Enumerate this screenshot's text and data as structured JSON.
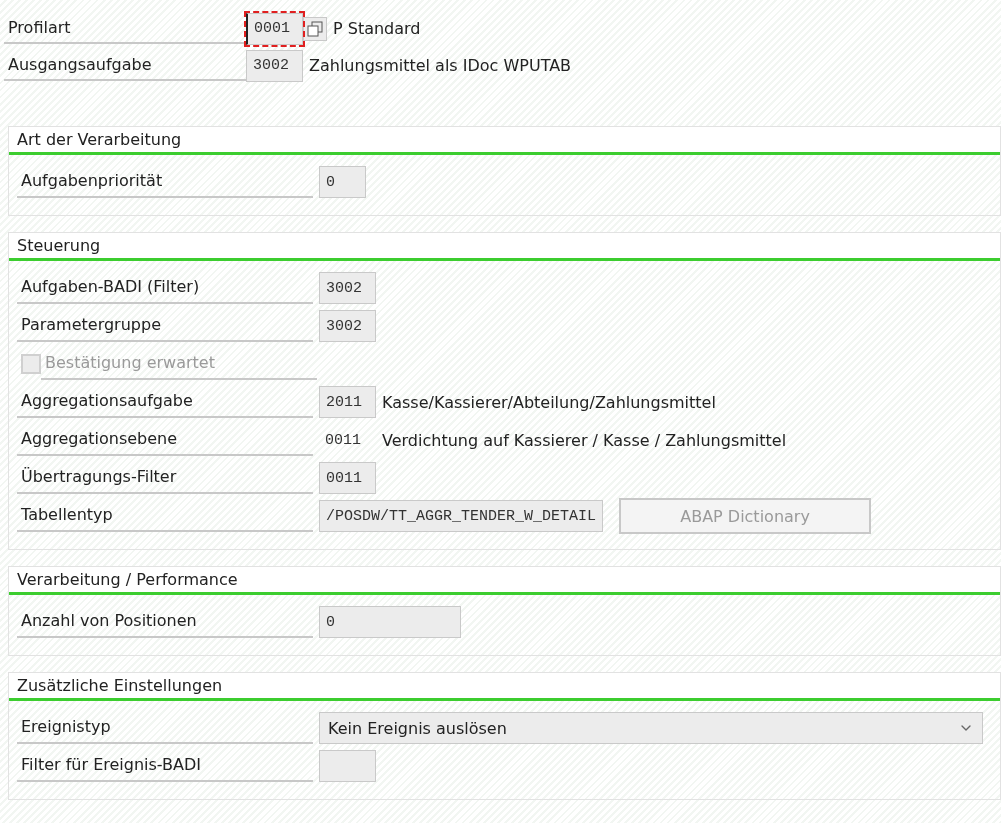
{
  "header_fields": [
    {
      "label": "Profilart",
      "value": "0001",
      "text": "P Standard",
      "focused": true,
      "value_help": true
    },
    {
      "label": "Ausgangsaufgabe",
      "value": "3002",
      "text": "Zahlungsmittel als IDoc WPUTAB",
      "focused": false,
      "value_help": false
    }
  ],
  "sections": [
    {
      "title": "Art der Verarbeitung",
      "rows": [
        {
          "kind": "wide_field",
          "label": "Aufgabenpriorität",
          "value": "0"
        }
      ]
    },
    {
      "title": "Steuerung",
      "rows": [
        {
          "kind": "field",
          "label": "Aufgaben-BADI (Filter)",
          "value": "3002"
        },
        {
          "kind": "field",
          "label": "Parametergruppe",
          "value": "3002"
        },
        {
          "kind": "checkbox",
          "label": "Bestätigung erwartet",
          "checked": false,
          "disabled": true
        },
        {
          "kind": "field",
          "label": "Aggregationsaufgabe",
          "value": "2011",
          "text": "Kasse/Kassierer/Abteilung/Zahlungsmittel"
        },
        {
          "kind": "display",
          "label": "Aggregationsebene",
          "value": "0011",
          "text": "Verdichtung auf Kassierer / Kasse / Zahlungsmittel"
        },
        {
          "kind": "field",
          "label": "Übertragungs-Filter",
          "value": "0011"
        },
        {
          "kind": "field_button",
          "label": "Tabellentyp",
          "value": "/POSDW/TT_AGGR_TENDER_W_DETAIL",
          "button": "ABAP Dictionary",
          "button_disabled": true
        }
      ]
    },
    {
      "title": "Verarbeitung / Performance",
      "rows": [
        {
          "kind": "long_field",
          "label": "Anzahl von Positionen",
          "value": "0"
        }
      ]
    },
    {
      "title": "Zusätzliche Einstellungen",
      "rows": [
        {
          "kind": "dropdown",
          "label": "Ereignistyp",
          "value": "Kein Ereignis auslösen"
        },
        {
          "kind": "field",
          "label": "Filter für Ereignis-BADI"
        }
      ]
    }
  ]
}
